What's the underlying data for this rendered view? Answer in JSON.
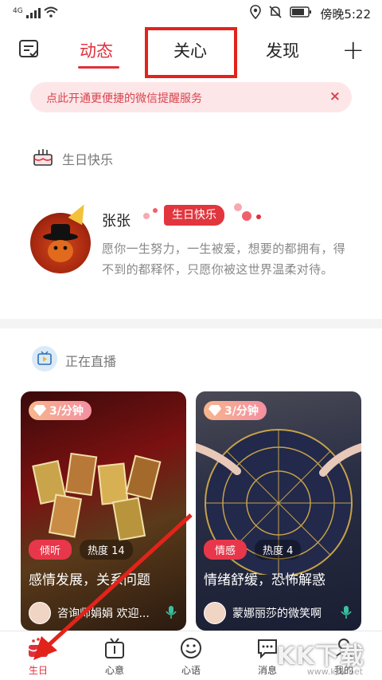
{
  "status_bar": {
    "network": "4G",
    "time": "傍晚5:22"
  },
  "top_nav": {
    "tabs": [
      "动态",
      "关心",
      "发现"
    ],
    "active_tab": "动态",
    "highlighted_tab": "关心"
  },
  "banner": {
    "text": "点此开通更便捷的微信提醒服务",
    "close": "×"
  },
  "birthday": {
    "section_title": "生日快乐",
    "name": "张张",
    "badge": "生日快乐",
    "message": "愿你一生努力，一生被爱，想要的都拥有，得不到的都释怀，只愿你被这世界温柔对待。"
  },
  "live": {
    "section_title": "正在直播",
    "cards": [
      {
        "price": "3/分钟",
        "category": "倾听",
        "heat": "热度 14",
        "title": "感情发展，关系问题",
        "host": "咨询师娟娟 欢迎..."
      },
      {
        "price": "3/分钟",
        "category": "情感",
        "heat": "热度 4",
        "title": "情绪舒缓，恐怖解惑",
        "host": "蒙娜丽莎的微笑啊"
      }
    ]
  },
  "bottom_nav": {
    "items": [
      "生日",
      "心意",
      "心语",
      "消息",
      "我的"
    ],
    "active": "生日"
  },
  "watermark": {
    "text": "KK下载",
    "sub": "www.kkx.net"
  },
  "colors": {
    "accent": "#e0303b",
    "banner_bg": "#fde6e8",
    "annotation_red": "#e2231a"
  }
}
